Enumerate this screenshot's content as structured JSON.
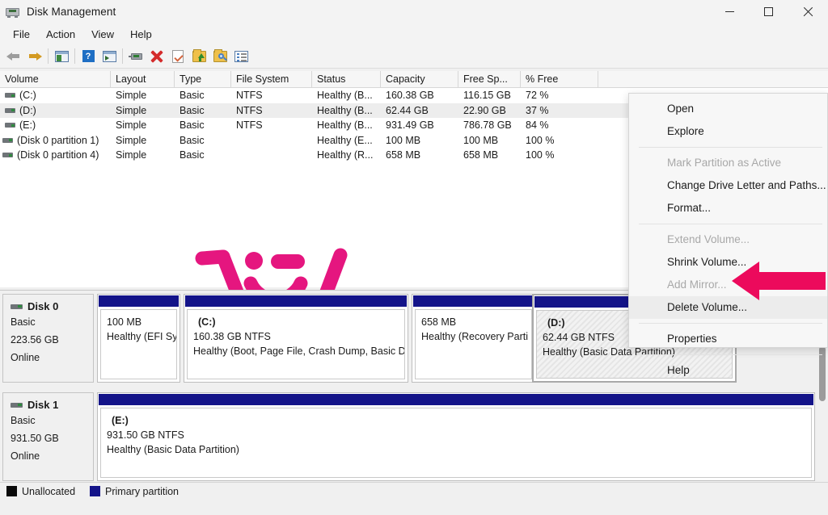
{
  "window": {
    "title": "Disk Management",
    "icon": "disk-drive-icon",
    "controls": {
      "minimize": "—",
      "maximize": "□",
      "close": "✕"
    }
  },
  "menubar": {
    "items": [
      "File",
      "Action",
      "View",
      "Help"
    ]
  },
  "toolbar": {
    "icons": [
      "back-arrow-icon",
      "forward-arrow-icon",
      "show-hide-console-tree-icon",
      "help-icon",
      "show-hide-action-pane-icon",
      "rescan-disks-icon",
      "delete-icon",
      "properties-icon",
      "export-list-icon",
      "find-icon",
      "view-list-icon"
    ]
  },
  "volume_list": {
    "columns": [
      "Volume",
      "Layout",
      "Type",
      "File System",
      "Status",
      "Capacity",
      "Free Sp...",
      "% Free"
    ],
    "rows": [
      {
        "volume": "(C:)",
        "layout": "Simple",
        "type": "Basic",
        "file_system": "NTFS",
        "status": "Healthy (B...",
        "capacity": "160.38 GB",
        "free_space": "116.15 GB",
        "percent_free": "72 %",
        "selected": false
      },
      {
        "volume": "(D:)",
        "layout": "Simple",
        "type": "Basic",
        "file_system": "NTFS",
        "status": "Healthy (B...",
        "capacity": "62.44 GB",
        "free_space": "22.90 GB",
        "percent_free": "37 %",
        "selected": true
      },
      {
        "volume": "(E:)",
        "layout": "Simple",
        "type": "Basic",
        "file_system": "NTFS",
        "status": "Healthy (B...",
        "capacity": "931.49 GB",
        "free_space": "786.78 GB",
        "percent_free": "84 %",
        "selected": false
      },
      {
        "volume": "(Disk 0 partition 1)",
        "layout": "Simple",
        "type": "Basic",
        "file_system": "",
        "status": "Healthy (E...",
        "capacity": "100 MB",
        "free_space": "100 MB",
        "percent_free": "100 %",
        "selected": false
      },
      {
        "volume": "(Disk 0 partition 4)",
        "layout": "Simple",
        "type": "Basic",
        "file_system": "",
        "status": "Healthy (R...",
        "capacity": "658 MB",
        "free_space": "658 MB",
        "percent_free": "100 %",
        "selected": false
      }
    ]
  },
  "graphical_view": {
    "disks": [
      {
        "name": "Disk 0",
        "kind": "Basic",
        "size": "223.56 GB",
        "state": "Online",
        "partitions": [
          {
            "label": "",
            "size": "100 MB",
            "status": "Healthy (EFI Sys",
            "selected": false
          },
          {
            "label": "(C:)",
            "size": "160.38 GB NTFS",
            "status": "Healthy (Boot, Page File, Crash Dump, Basic D",
            "selected": false
          },
          {
            "label": "",
            "size": "658 MB",
            "status": "Healthy (Recovery Parti",
            "selected": false
          },
          {
            "label": "(D:)",
            "size": "62.44 GB NTFS",
            "status": "Healthy (Basic Data Partition)",
            "selected": true
          }
        ]
      },
      {
        "name": "Disk 1",
        "kind": "Basic",
        "size": "931.50 GB",
        "state": "Online",
        "partitions": [
          {
            "label": "(E:)",
            "size": "931.50 GB NTFS",
            "status": "Healthy (Basic Data Partition)",
            "selected": false
          }
        ]
      }
    ]
  },
  "legend": {
    "items": [
      {
        "label": "Unallocated",
        "color": "#0a0a0a"
      },
      {
        "label": "Primary partition",
        "color": "#141489"
      }
    ]
  },
  "context_menu": {
    "items": [
      {
        "label": "Open",
        "disabled": false,
        "hover": false
      },
      {
        "label": "Explore",
        "disabled": false,
        "hover": false
      },
      {
        "separator": true
      },
      {
        "label": "Mark Partition as Active",
        "disabled": true,
        "hover": false
      },
      {
        "label": "Change Drive Letter and Paths...",
        "disabled": false,
        "hover": false
      },
      {
        "label": "Format...",
        "disabled": false,
        "hover": false
      },
      {
        "separator": true
      },
      {
        "label": "Extend Volume...",
        "disabled": true,
        "hover": false
      },
      {
        "label": "Shrink Volume...",
        "disabled": false,
        "hover": false
      },
      {
        "label": "Add Mirror...",
        "disabled": true,
        "hover": false
      },
      {
        "label": "Delete Volume...",
        "disabled": false,
        "hover": true
      },
      {
        "separator": true
      },
      {
        "label": "Properties",
        "disabled": false,
        "hover": false
      },
      {
        "separator": true
      },
      {
        "label": "Help",
        "disabled": false,
        "hover": false
      }
    ]
  },
  "annotation": {
    "arrow_color": "#ec0a5c",
    "points_to": "Delete Volume..."
  },
  "watermark": {
    "color": "#e5167f",
    "name": "jumping-figure-logo"
  },
  "colors": {
    "partition_bar": "#141489",
    "window_background": "#f0f0f0",
    "list_background": "#ffffff",
    "accent_pink": "#ec0a5c"
  }
}
